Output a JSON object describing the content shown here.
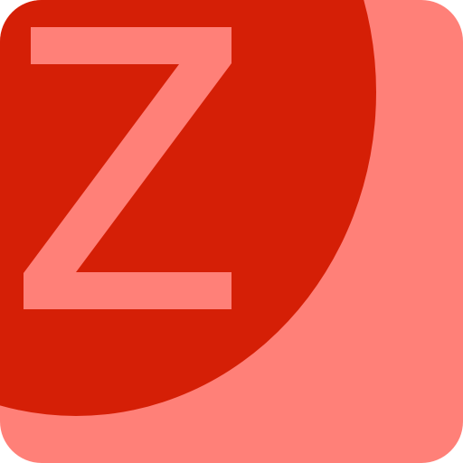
{
  "icon": {
    "letter": "Z",
    "colors": {
      "background": "#ff8078",
      "circle": "#d51f06",
      "letter": "#ff8078"
    }
  }
}
